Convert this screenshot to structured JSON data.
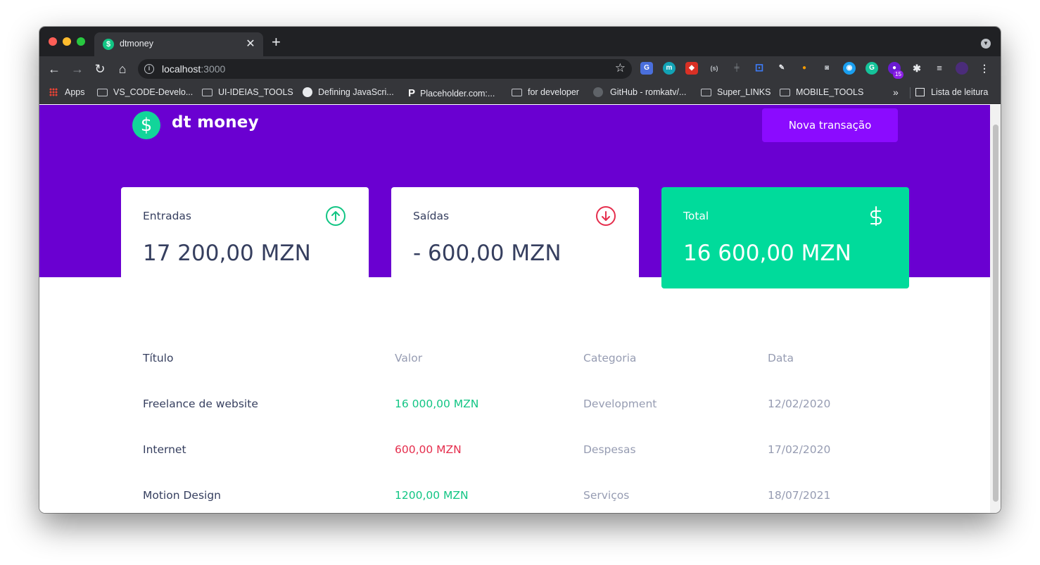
{
  "browser": {
    "tab_title": "dtmoney",
    "tab_favicon": "$",
    "new_tab": "+",
    "url_host": "localhost",
    "url_port": ":3000",
    "extension_badge": "15"
  },
  "bookmarks": {
    "items": [
      "Apps",
      "VS_CODE-Develo...",
      "UI-IDEIAS_TOOLS",
      "Defining JavaScri...",
      "Placeholder.com:...",
      "for developer",
      "GitHub - romkatv/...",
      "Super_LINKS",
      "MOBILE_TOOLS"
    ],
    "more": "»",
    "reading_list": "Lista de leitura"
  },
  "header": {
    "logo_symbol": "$",
    "logo_text": "dt money",
    "new_transaction_label": "Nova transação"
  },
  "summary": {
    "income": {
      "label": "Entradas",
      "value": "17 200,00 MZN",
      "icon": "arrow-up-circle-icon"
    },
    "outcome": {
      "label": "Saídas",
      "value": "- 600,00 MZN",
      "icon": "arrow-down-circle-icon"
    },
    "total": {
      "label": "Total",
      "value": "16 600,00 MZN",
      "icon": "dollar-icon"
    }
  },
  "table": {
    "headers": [
      "Título",
      "Valor",
      "Categoria",
      "Data"
    ],
    "rows": [
      {
        "title": "Freelance de website",
        "value": "16 000,00 MZN",
        "type": "deposit",
        "category": "Development",
        "date": "12/02/2020"
      },
      {
        "title": "Internet",
        "value": "600,00 MZN",
        "type": "withdraw",
        "category": "Despesas",
        "date": "17/02/2020"
      },
      {
        "title": "Motion Design",
        "value": "1200,00 MZN",
        "type": "deposit",
        "category": "Serviços",
        "date": "18/07/2021"
      }
    ]
  },
  "colors": {
    "brand_purple": "#6a00d1",
    "button_purple": "#8b0bff",
    "green": "#00db9b",
    "red": "#e52e4d",
    "text_title": "#363f5f",
    "text_body": "#969cb2"
  }
}
